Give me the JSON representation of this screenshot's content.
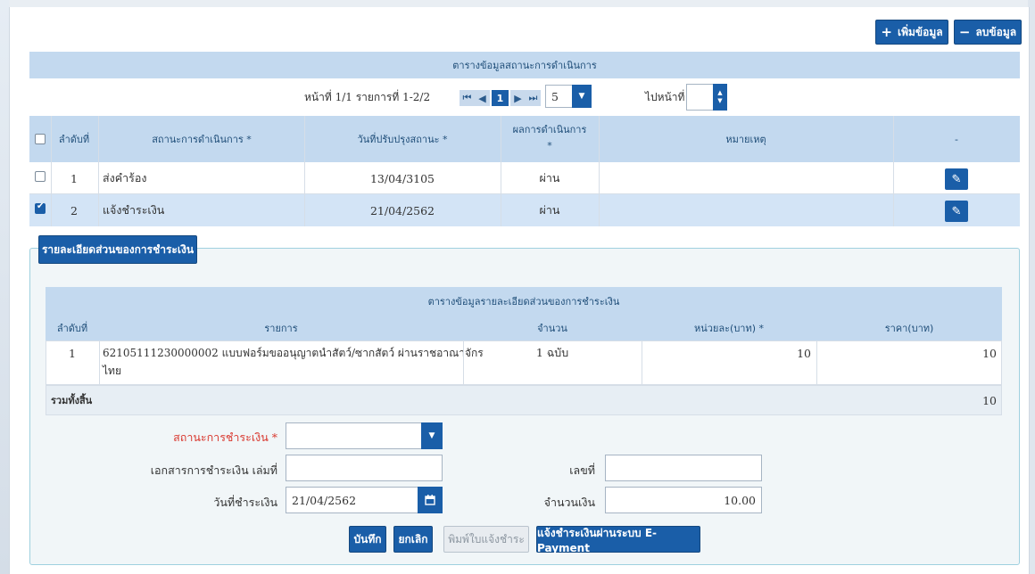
{
  "toolbar": {
    "add_label": "เพิ่มข้อมูล",
    "delete_label": "ลบข้อมูล"
  },
  "status_table": {
    "title": "ตารางข้อมูลสถานะการดำเนินการ",
    "page_info": "หน้าที่ 1/1 รายการที่ 1-2/2",
    "current_page": "1",
    "page_size": "5",
    "goto_label": "ไปหน้าที่",
    "goto_value": "",
    "columns": [
      "ลำดับที่",
      "สถานะการดำเนินการ *",
      "วันที่ปรับปรุงสถานะ *",
      "ผลการดำเนินการ",
      "*",
      "หมายเหตุ",
      "-"
    ],
    "rows": [
      {
        "no": "1",
        "status": "ส่งคำร้อง",
        "date": "13/04/3105",
        "result": "ผ่าน",
        "note": "",
        "checked": false
      },
      {
        "no": "2",
        "status": "แจ้งชำระเงิน",
        "date": "21/04/2562",
        "result": "ผ่าน",
        "note": "",
        "checked": true
      }
    ]
  },
  "payment": {
    "tab_label": "รายละเอียดส่วนของการชำระเงิน",
    "table_title": "ตารางข้อมูลรายละเอียดส่วนของการชำระเงิน",
    "columns": [
      "ลำดับที่",
      "รายการ",
      "จำนวน",
      "หน่วยละ(บาท) *",
      "ราคา(บาท)"
    ],
    "rows": [
      {
        "no": "1",
        "item_line1": "62105111230000002 แบบฟอร์มขออนุญาตนำสัตว์/ซากสัตว์ ผ่านราชอาณาจักร",
        "item_line2": "ไทย",
        "qty": "1 ฉบับ",
        "unit_price": "10",
        "price": "10"
      }
    ],
    "total_label": "รวมทั้งสิ้น",
    "total_value": "10"
  },
  "form": {
    "status_label": "สถานะการชำระเงิน *",
    "status_value": "",
    "doc_label": "เอกสารการชำระเงิน เล่มที่",
    "doc_value": "",
    "number_label": "เลขที่",
    "number_value": "",
    "date_label": "วันที่ชำระเงิน",
    "date_value": "21/04/2562",
    "amount_label": "จำนวนเงิน",
    "amount_value": "10.00"
  },
  "actions": {
    "save": "บันทึก",
    "cancel": "ยกเลิก",
    "print": "พิมพ์ใบแจ้งชำระ",
    "epay": "แจ้งชำระเงินผ่านระบบ E-Payment"
  },
  "colors": {
    "primary": "#1a5ea8",
    "header": "#c3d9ef",
    "selected_row": "#d3e4f6",
    "required": "#d9382f"
  }
}
